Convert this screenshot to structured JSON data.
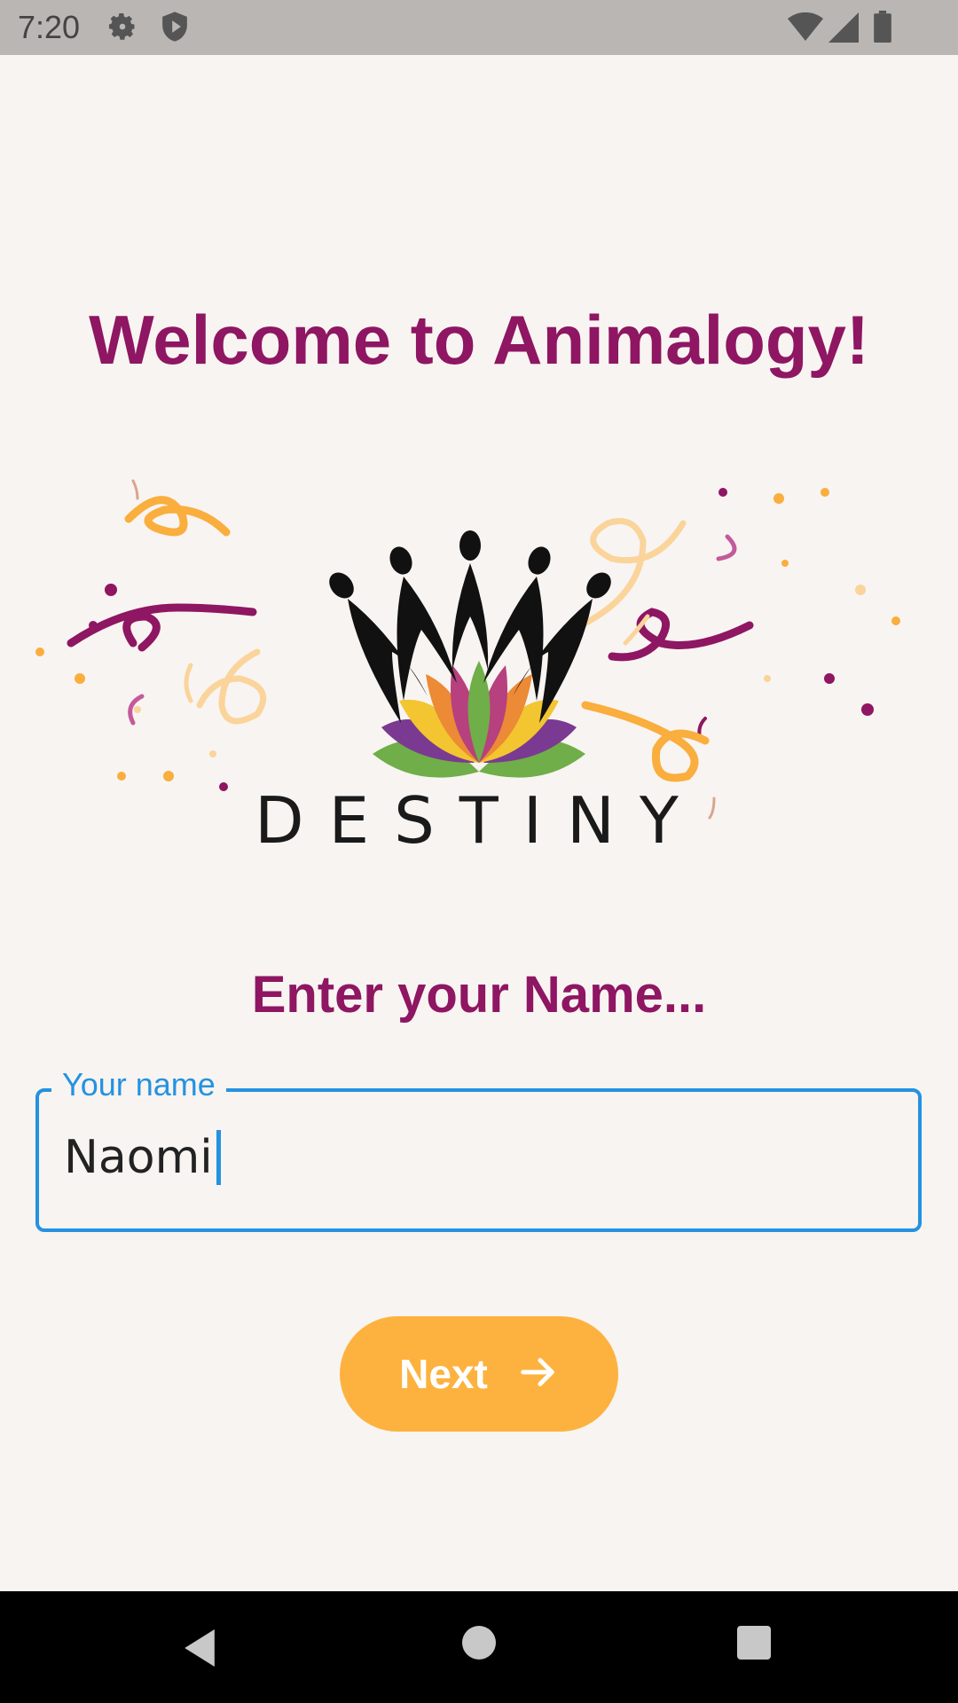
{
  "status_bar": {
    "time": "7:20",
    "icons": [
      "gear-icon",
      "shield-icon",
      "wifi-icon",
      "signal-icon",
      "battery-icon"
    ]
  },
  "welcome": {
    "title": "Welcome to Animalogy!"
  },
  "logo": {
    "wordmark": "DESTINY"
  },
  "name_prompt": "Enter your Name...",
  "name_field": {
    "label": "Your name",
    "value": "Naomi"
  },
  "next_button": {
    "label": "Next",
    "icon": "arrow-right-icon"
  },
  "nav_bar": {
    "icons": [
      "back-icon",
      "home-icon",
      "recents-icon"
    ]
  },
  "colors": {
    "accent": "#8e1662",
    "button": "#fdb23f",
    "focus": "#2492e0",
    "background": "#f8f4f1"
  }
}
